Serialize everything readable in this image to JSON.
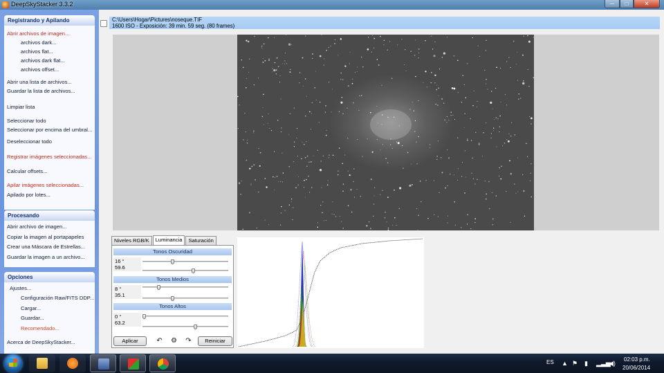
{
  "window": {
    "title": "DeepSkyStacker 3.3.2",
    "min": "─",
    "max": "□",
    "close": "✕"
  },
  "panel": {
    "registering": {
      "header": "Registrando y Apilando",
      "items": [
        "Abrir archivos de imagen...",
        "archivos dark...",
        "archivos flat...",
        "archivos dark flat...",
        "archivos offset...",
        "Abrir una lista de archivos...",
        "Guardar la lista de archivos...",
        "Limpiar lista",
        "Seleccionar todo",
        "Seleccionar por encima del umbral...",
        "Deseleccionar todo",
        "Registrar imágenes seleccionadas...",
        "Calcular offsets...",
        "Apilar imágenes seleccionadas...",
        "Apilado por lotes..."
      ]
    },
    "processing": {
      "header": "Procesando",
      "items": [
        "Abrir archivo de imagen...",
        "Copiar la imagen al portapapeles",
        "Crear una Máscara de Estrellas...",
        "Guardar la imagen a un archivo..."
      ]
    },
    "options": {
      "header": "Opciones",
      "items": [
        "Ajustes...",
        "Configuración Raw/FITS DDP...",
        "Cargar...",
        "Guardar...",
        "Recomendado...",
        "Acerca de DeepSkyStacker..."
      ]
    }
  },
  "info": {
    "path": "C:\\Users\\Hogar\\Pictures\\noseque.TIF",
    "details": "1600 ISO - Exposición: 39 min. 59 seg. (80 frames)"
  },
  "tabs": [
    "Niveles RGB/K",
    "Luminancia",
    "Saturación"
  ],
  "active_tab": "Luminancia",
  "luminance": {
    "sections": [
      {
        "title": "Tonos Oscuridad",
        "angle": "16 °",
        "value": "59.6",
        "angle_pos": 0.35,
        "value_pos": 0.6
      },
      {
        "title": "Tonos Medios",
        "angle": "8 °",
        "value": "35.1",
        "angle_pos": 0.18,
        "value_pos": 0.35
      },
      {
        "title": "Tonos Altos",
        "angle": "0 °",
        "value": "63.2",
        "angle_pos": 0.0,
        "value_pos": 0.63
      }
    ],
    "apply_label": "Aplicar",
    "reset_label": "Reiniciar",
    "undo_icon": "↶",
    "settings_icon": "⚙",
    "redo_icon": "↷"
  },
  "colors": {
    "histogram_red": "#d02020",
    "histogram_green": "#20a020",
    "histogram_blue": "#2030c0",
    "danger_text": "#c0291b"
  },
  "taskbar": {
    "language": "ES",
    "time": "02:03 p.m.",
    "date": "20/06/2014",
    "icons": [
      "start-orb",
      "file-explorer-icon",
      "media-player-icon",
      "deepskystacker-icon",
      "dss-live-icon",
      "chrome-icon"
    ]
  }
}
